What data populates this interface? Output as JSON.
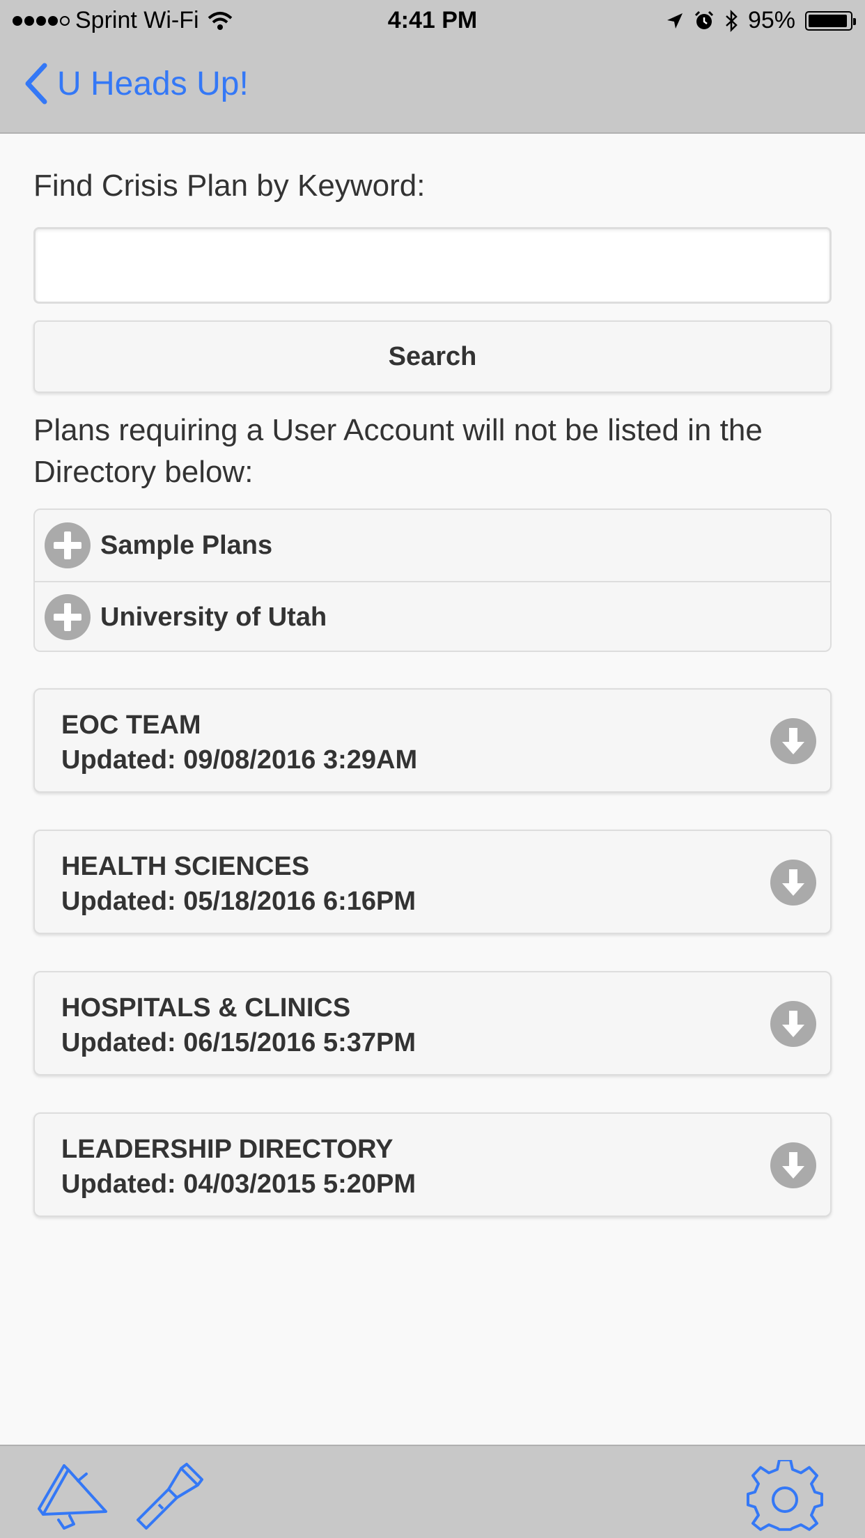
{
  "status_bar": {
    "carrier": "Sprint Wi-Fi",
    "time": "4:41 PM",
    "battery": "95%",
    "battery_level": 0.95
  },
  "nav": {
    "back_label": "U Heads Up!"
  },
  "search": {
    "label": "Find Crisis Plan by Keyword:",
    "value": "",
    "placeholder": "",
    "button_label": "Search"
  },
  "note": "Plans requiring a User Account will not be listed in the Directory below:",
  "directory": [
    {
      "label": "Sample Plans"
    },
    {
      "label": "University of Utah"
    }
  ],
  "plans": [
    {
      "title": "EOC TEAM",
      "updated": "Updated: 09/08/2016 3:29AM"
    },
    {
      "title": "HEALTH SCIENCES",
      "updated": "Updated: 05/18/2016 6:16PM"
    },
    {
      "title": "HOSPITALS & CLINICS",
      "updated": "Updated: 06/15/2016 5:37PM"
    },
    {
      "title": "LEADERSHIP DIRECTORY",
      "updated": "Updated: 04/03/2015 5:20PM"
    }
  ],
  "tab_bar": {
    "icons": [
      "megaphone-icon",
      "flashlight-icon",
      "gear-icon"
    ]
  },
  "colors": {
    "accent": "#3478f6",
    "bar_background": "#c8c8c8",
    "icon_gray": "#aaaaaa"
  }
}
